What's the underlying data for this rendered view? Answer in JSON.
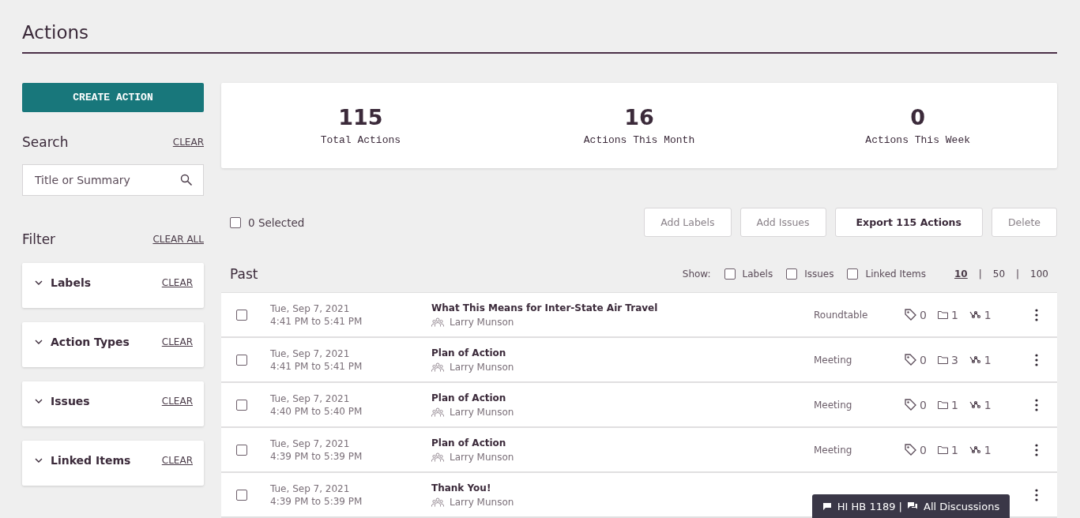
{
  "page": {
    "title": "Actions"
  },
  "sidebar": {
    "create_button": "CREATE ACTION",
    "search": {
      "heading": "Search",
      "clear": "CLEAR",
      "placeholder": "Title or Summary"
    },
    "filter": {
      "heading": "Filter",
      "clear_all": "CLEAR ALL",
      "groups": [
        {
          "label": "Labels",
          "clear": "CLEAR"
        },
        {
          "label": "Action Types",
          "clear": "CLEAR"
        },
        {
          "label": "Issues",
          "clear": "CLEAR"
        },
        {
          "label": "Linked Items",
          "clear": "CLEAR"
        }
      ]
    }
  },
  "stats": [
    {
      "value": "115",
      "label": "Total Actions"
    },
    {
      "value": "16",
      "label": "Actions This Month"
    },
    {
      "value": "0",
      "label": "Actions This Week"
    }
  ],
  "toolbar": {
    "select_all": {
      "label": "0 Selected",
      "checked": false
    },
    "buttons": [
      {
        "label": "Add Labels",
        "disabled": true
      },
      {
        "label": "Add Issues",
        "disabled": true
      },
      {
        "label": "Export 115 Actions",
        "disabled": false
      },
      {
        "label": "Delete",
        "disabled": true
      }
    ]
  },
  "list": {
    "heading": "Past",
    "show_label": "Show:",
    "show_options": [
      {
        "label": "Labels",
        "checked": false
      },
      {
        "label": "Issues",
        "checked": false
      },
      {
        "label": "Linked Items",
        "checked": false
      }
    ],
    "separator": "|",
    "page_sizes": [
      {
        "label": "10",
        "selected": true
      },
      {
        "label": "50",
        "selected": false
      },
      {
        "label": "100",
        "selected": false
      }
    ],
    "rows": [
      {
        "checked": false,
        "date": "Tue, Sep 7, 2021",
        "time": "4:41 PM to 5:41 PM",
        "title": "What This Means for Inter-State Air Travel",
        "owner": "Larry Munson",
        "type": "Roundtable",
        "labels": "0",
        "issues": "1",
        "links": "1"
      },
      {
        "checked": false,
        "date": "Tue, Sep 7, 2021",
        "time": "4:41 PM to 5:41 PM",
        "title": "Plan of Action",
        "owner": "Larry Munson",
        "type": "Meeting",
        "labels": "0",
        "issues": "3",
        "links": "1"
      },
      {
        "checked": false,
        "date": "Tue, Sep 7, 2021",
        "time": "4:40 PM to 5:40 PM",
        "title": "Plan of Action",
        "owner": "Larry Munson",
        "type": "Meeting",
        "labels": "0",
        "issues": "1",
        "links": "1"
      },
      {
        "checked": false,
        "date": "Tue, Sep 7, 2021",
        "time": "4:39 PM to 5:39 PM",
        "title": "Plan of Action",
        "owner": "Larry Munson",
        "type": "Meeting",
        "labels": "0",
        "issues": "1",
        "links": "1"
      },
      {
        "checked": false,
        "date": "Tue, Sep 7, 2021",
        "time": "4:39 PM to 5:39 PM",
        "title": "Thank You!",
        "owner": "Larry Munson"
      }
    ]
  },
  "discussion_bar": {
    "current": "HI HB 1189 |",
    "all": "All Discussions"
  }
}
